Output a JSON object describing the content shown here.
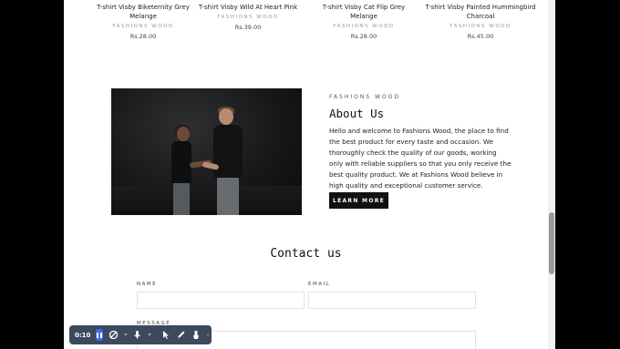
{
  "products": [
    {
      "title": "T-shirt Visby Biketernity Grey Melange",
      "vendor": "FASHIONS WOOD",
      "price": "Rs.28.00"
    },
    {
      "title": "T-shirt Visby Wild At Heart Pink",
      "vendor": "FASHIONS WOOD",
      "price": "Rs.39.00"
    },
    {
      "title": "T-shirt Visby Cat Flip Grey Melange",
      "vendor": "FASHIONS WOOD",
      "price": "Rs.28.00"
    },
    {
      "title": "T-shirt Visby Painted Hummingbird Charcoal",
      "vendor": "FASHIONS WOOD",
      "price": "Rs.45.00"
    }
  ],
  "about": {
    "eyebrow": "FASHIONS WOOD",
    "heading": "About Us",
    "body": "Hello and welcome to Fashions Wood, the place to find the best product for every taste and occasion. We thoroughly check the quality of our goods, working only with reliable suppliers so that you only receive the best quality product. We at Fashions Wood believe in high quality and exceptional customer service.",
    "button": "LEARN MORE"
  },
  "contact": {
    "title": "Contact us",
    "name_label": "NAME",
    "email_label": "EMAIL",
    "message_label": "MESSAGE"
  },
  "recorder": {
    "time": "0:10"
  }
}
